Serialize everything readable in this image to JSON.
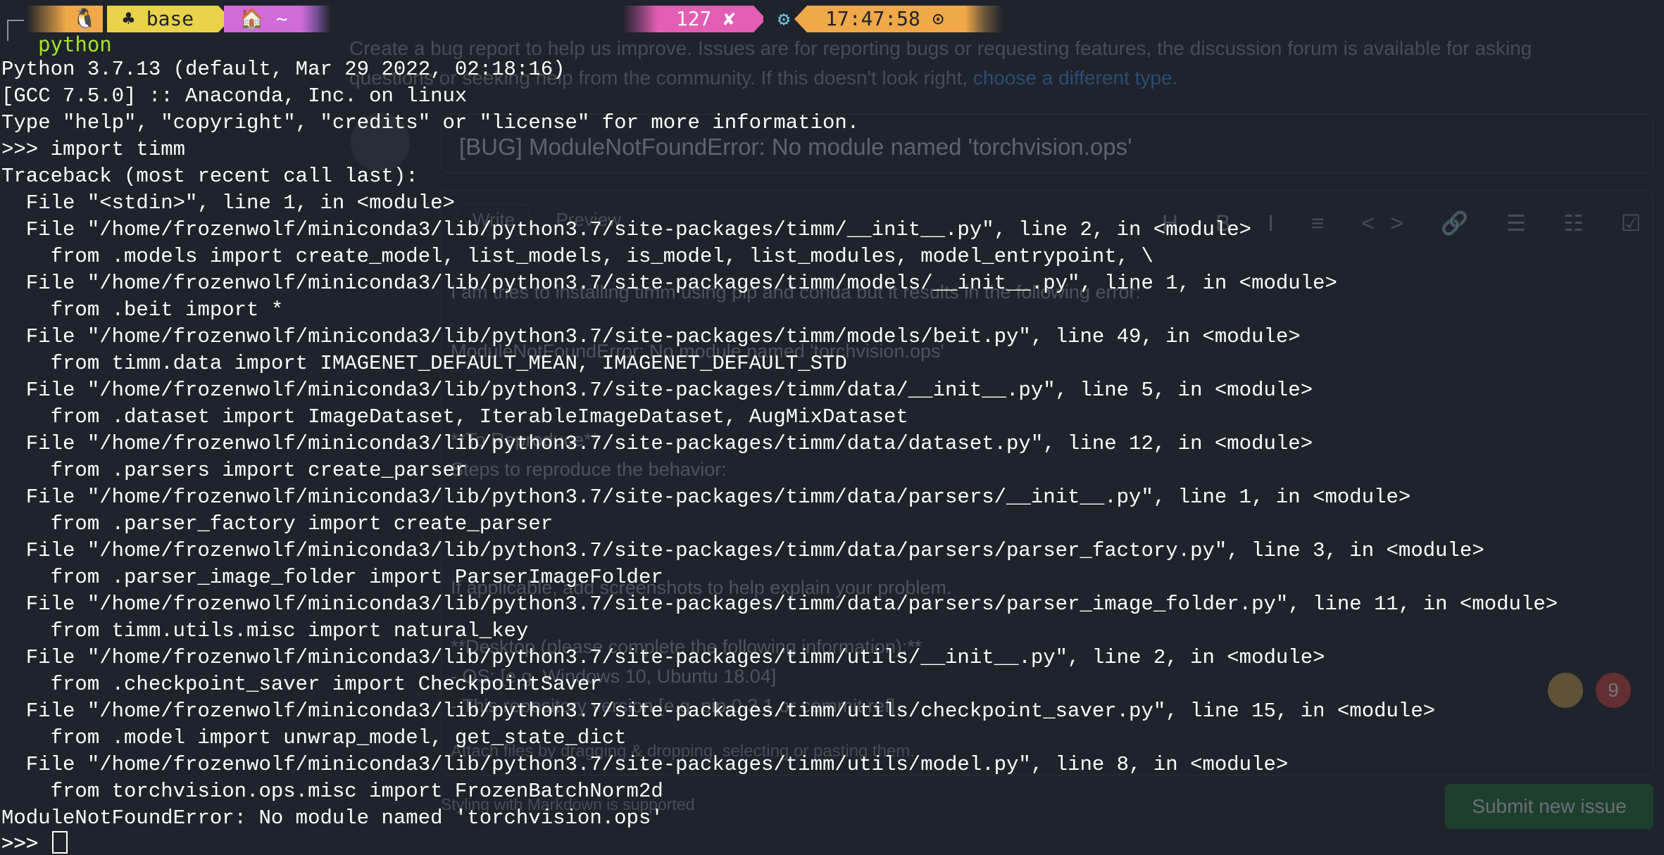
{
  "colors": {
    "background": "#1f232b",
    "text": "#ffffff",
    "command": "#a6e22e",
    "seg_os": "#f0a848",
    "seg_env": "#e8d34a",
    "seg_home": "#d16bd9",
    "seg_status": "#e35db4",
    "seg_time": "#f0a848"
  },
  "prompt_bar": {
    "os_icon": "linux-penguin-icon",
    "os_glyph": "🐧",
    "env_icon": "python-env-icon",
    "env_glyph": "♣",
    "env_name": "base",
    "home_icon": "home-icon",
    "home_glyph": "🏠",
    "cwd": "~",
    "exit_code": "127 ✘",
    "gear_glyph": "⚙",
    "time": "17:47:58 ⊙"
  },
  "terminal": {
    "command": "python",
    "lines": [
      "Python 3.7.13 (default, Mar 29 2022, 02:18:16)",
      "[GCC 7.5.0] :: Anaconda, Inc. on linux",
      "Type \"help\", \"copyright\", \"credits\" or \"license\" for more information.",
      ">>> import timm",
      "Traceback (most recent call last):",
      "  File \"<stdin>\", line 1, in <module>",
      "  File \"/home/frozenwolf/miniconda3/lib/python3.7/site-packages/timm/__init__.py\", line 2, in <module>",
      "    from .models import create_model, list_models, is_model, list_modules, model_entrypoint, \\",
      "  File \"/home/frozenwolf/miniconda3/lib/python3.7/site-packages/timm/models/__init__.py\", line 1, in <module>",
      "    from .beit import *",
      "  File \"/home/frozenwolf/miniconda3/lib/python3.7/site-packages/timm/models/beit.py\", line 49, in <module>",
      "    from timm.data import IMAGENET_DEFAULT_MEAN, IMAGENET_DEFAULT_STD",
      "  File \"/home/frozenwolf/miniconda3/lib/python3.7/site-packages/timm/data/__init__.py\", line 5, in <module>",
      "    from .dataset import ImageDataset, IterableImageDataset, AugMixDataset",
      "  File \"/home/frozenwolf/miniconda3/lib/python3.7/site-packages/timm/data/dataset.py\", line 12, in <module>",
      "    from .parsers import create_parser",
      "  File \"/home/frozenwolf/miniconda3/lib/python3.7/site-packages/timm/data/parsers/__init__.py\", line 1, in <module>",
      "    from .parser_factory import create_parser",
      "  File \"/home/frozenwolf/miniconda3/lib/python3.7/site-packages/timm/data/parsers/parser_factory.py\", line 3, in <module>",
      "    from .parser_image_folder import ParserImageFolder",
      "  File \"/home/frozenwolf/miniconda3/lib/python3.7/site-packages/timm/data/parsers/parser_image_folder.py\", line 11, in <module>",
      "    from timm.utils.misc import natural_key",
      "  File \"/home/frozenwolf/miniconda3/lib/python3.7/site-packages/timm/utils/__init__.py\", line 2, in <module>",
      "    from .checkpoint_saver import CheckpointSaver",
      "  File \"/home/frozenwolf/miniconda3/lib/python3.7/site-packages/timm/utils/checkpoint_saver.py\", line 15, in <module>",
      "    from .model import unwrap_model, get_state_dict",
      "  File \"/home/frozenwolf/miniconda3/lib/python3.7/site-packages/timm/utils/model.py\", line 8, in <module>",
      "    from torchvision.ops.misc import FrozenBatchNorm2d",
      "ModuleNotFoundError: No module named 'torchvision.ops'"
    ],
    "final_prompt": ">>> "
  },
  "background_page": {
    "description": "Create a bug report to help us improve. Issues are for reporting bugs or requesting features, the discussion forum is available for asking questions or seeking help from the community. If this doesn't look right,",
    "description_link": "choose a different type.",
    "title_value": "[BUG] ModuleNotFoundError: No module named 'torchvision.ops'",
    "tab_write": "Write",
    "tab_preview": "Preview",
    "toolbar_glyphs": "H B I ≡ <> 🔗 ☰ ☷ ☑ @ ↗ ↶",
    "body_lines": [
      "I am tries to installing timm using pip and conda but it results in the following error:",
      "ModuleNotFoundError: No module named 'torchvision.ops'",
      "**To Reproduce**",
      "Steps to reproduce the behavior:",
      "If applicable, add screenshots to help explain your problem.",
      "**Desktop (please complete the following information):**",
      " - OS: [e.g. Windows 10, Ubuntu 18.04]",
      " - This repository version [e.g. pip 0.3.1 or commit ref]"
    ],
    "attach_hint": "Attach files by dragging & dropping, selecting or pasting them.",
    "markdown_note": "Styling with Markdown is supported",
    "submit_label": "Submit new issue",
    "notification_count": "9"
  }
}
